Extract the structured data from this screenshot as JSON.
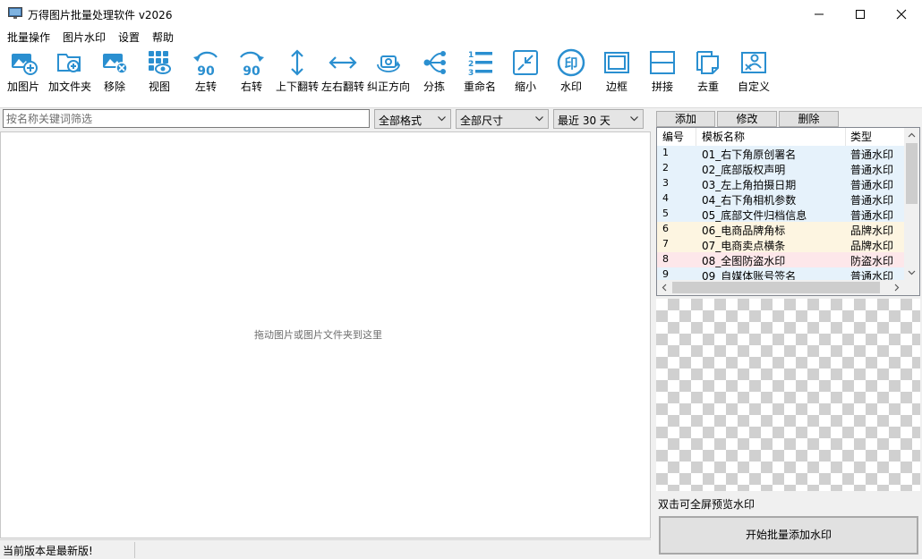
{
  "window": {
    "title": "万得图片批量处理软件 v2026",
    "icon": "monitor-icon"
  },
  "menu": [
    "批量操作",
    "图片水印",
    "设置",
    "帮助"
  ],
  "toolbar": [
    {
      "label": "加图片",
      "icon": "add-image-icon"
    },
    {
      "label": "加文件夹",
      "icon": "add-folder-icon"
    },
    {
      "label": "移除",
      "icon": "remove-image-icon"
    },
    {
      "label": "视图",
      "icon": "view-icon"
    },
    {
      "label": "左转",
      "icon": "rotate-left-icon",
      "glyph": "90"
    },
    {
      "label": "右转",
      "icon": "rotate-right-icon",
      "glyph": "90"
    },
    {
      "label": "上下翻转",
      "icon": "flip-vertical-icon"
    },
    {
      "label": "左右翻转",
      "icon": "flip-horizontal-icon"
    },
    {
      "label": "纠正方向",
      "icon": "correct-orientation-icon"
    },
    {
      "label": "分拣",
      "icon": "sort-icon"
    },
    {
      "label": "重命名",
      "icon": "rename-icon",
      "glyph": "123"
    },
    {
      "label": "缩小",
      "icon": "shrink-icon"
    },
    {
      "label": "水印",
      "icon": "watermark-icon",
      "glyph": "印"
    },
    {
      "label": "边框",
      "icon": "border-icon"
    },
    {
      "label": "拼接",
      "icon": "stitch-icon"
    },
    {
      "label": "去重",
      "icon": "dedupe-icon"
    },
    {
      "label": "自定义",
      "icon": "custom-icon"
    }
  ],
  "filter": {
    "search_placeholder": "按名称关键词筛选",
    "format": "全部格式",
    "size": "全部尺寸",
    "date": "最近 30 天"
  },
  "drop_hint": "拖动图片或图片文件夹到这里",
  "template_buttons": [
    "添加",
    "修改",
    "删除"
  ],
  "template_table": {
    "columns": [
      "编号",
      "模板名称",
      "类型"
    ],
    "rows": [
      {
        "id": "1",
        "name": "01_右下角原创署名",
        "type": "普通水印",
        "color": "#e6f2fb"
      },
      {
        "id": "2",
        "name": "02_底部版权声明",
        "type": "普通水印",
        "color": "#e6f2fb"
      },
      {
        "id": "3",
        "name": "03_左上角拍摄日期",
        "type": "普通水印",
        "color": "#e6f2fb"
      },
      {
        "id": "4",
        "name": "04_右下角相机参数",
        "type": "普通水印",
        "color": "#e6f2fb"
      },
      {
        "id": "5",
        "name": "05_底部文件归档信息",
        "type": "普通水印",
        "color": "#e6f2fb"
      },
      {
        "id": "6",
        "name": "06_电商品牌角标",
        "type": "品牌水印",
        "color": "#fdf5e1"
      },
      {
        "id": "7",
        "name": "07_电商卖点横条",
        "type": "品牌水印",
        "color": "#fdf5e1"
      },
      {
        "id": "8",
        "name": "08_全图防盗水印",
        "type": "防盗水印",
        "color": "#fde7ea"
      },
      {
        "id": "9",
        "name": "09_自媒体账号签名",
        "type": "普通水印",
        "color": "#e6f2fb"
      }
    ]
  },
  "preview_hint": "双击可全屏预览水印",
  "start_button": "开始批量添加水印",
  "status": "当前版本是最新版!",
  "colors": {
    "icon_blue": "#2a8fd0"
  }
}
